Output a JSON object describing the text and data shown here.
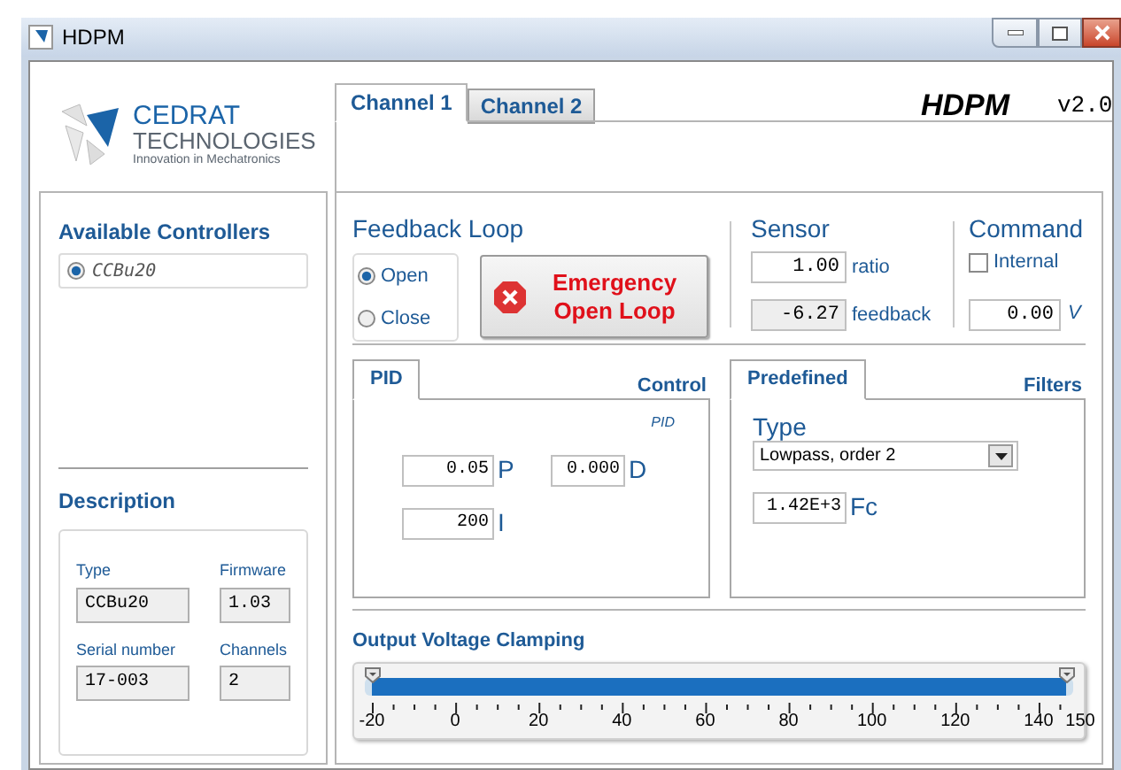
{
  "window": {
    "title": "HDPM"
  },
  "logo": {
    "name": "CEDRAT",
    "subname": "TECHNOLOGIES",
    "tagline": "Innovation in Mechatronics"
  },
  "channel_tabs": [
    {
      "label": "Channel 1",
      "selected": true
    },
    {
      "label": "Channel 2",
      "selected": false
    }
  ],
  "app_title": "HDPM",
  "version": "v2.0",
  "controllers": {
    "title": "Available Controllers",
    "items": [
      {
        "label": "CCBu20",
        "selected": true
      }
    ]
  },
  "description": {
    "title": "Description",
    "fields": [
      {
        "label": "Type",
        "value": "CCBu20"
      },
      {
        "label": "Firmware",
        "value": "1.03"
      },
      {
        "label": "Serial number",
        "value": "17-003"
      },
      {
        "label": "Channels",
        "value": "2"
      }
    ]
  },
  "feedback_loop": {
    "title": "Feedback Loop",
    "options": [
      {
        "label": "Open",
        "selected": true
      },
      {
        "label": "Close",
        "selected": false
      }
    ],
    "emergency_button": "Emergency Open Loop"
  },
  "sensor": {
    "title": "Sensor",
    "fields": [
      {
        "value": "1.00",
        "unit": "ratio",
        "disabled": false
      },
      {
        "value": "-6.27",
        "unit": "feedback",
        "disabled": true
      }
    ]
  },
  "command": {
    "title": "Command",
    "internal": {
      "label": "Internal",
      "checked": false
    },
    "value": "0.00",
    "unit": "V"
  },
  "pid_panel": {
    "tab": "PID",
    "heading": "Control",
    "subtitle": "PID",
    "params": [
      {
        "value": "0.05",
        "label": "P"
      },
      {
        "value": "0.000",
        "label": "D"
      },
      {
        "value": "200",
        "label": "I"
      }
    ]
  },
  "filters_panel": {
    "tab": "Predefined",
    "heading": "Filters",
    "type_label": "Type",
    "type_value": "Lowpass, order 2",
    "fc": {
      "value": "1.42E+3",
      "label": "Fc"
    }
  },
  "clamping": {
    "title": "Output Voltage Clamping",
    "thumbs": [
      {
        "level": 0
      },
      {
        "level": 1
      }
    ],
    "scale": [
      "-20",
      "0",
      "20",
      "40",
      "60",
      "80",
      "100",
      "120",
      "140",
      "150"
    ]
  }
}
